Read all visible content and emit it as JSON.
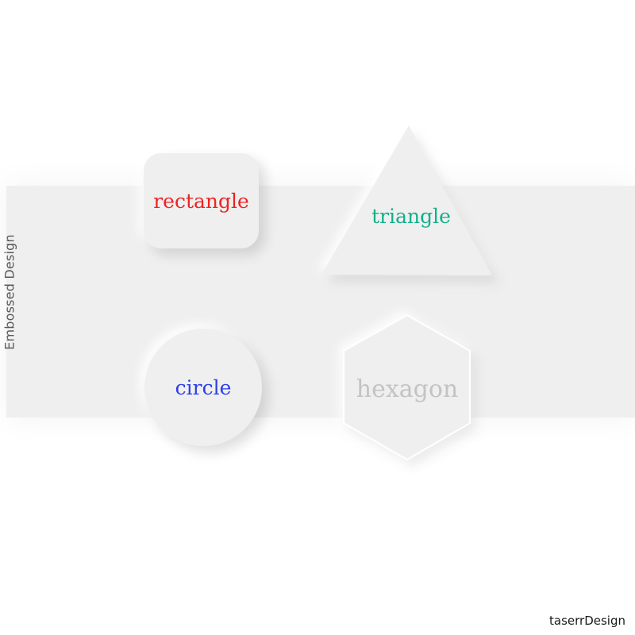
{
  "side_title": "Embossed Design",
  "credit": "taserrDesign",
  "shapes": {
    "rectangle": {
      "label": "rectangle",
      "color": "#f02222"
    },
    "triangle": {
      "label": "triangle",
      "color": "#12b08a"
    },
    "circle": {
      "label": "circle",
      "color": "#2c3ee6"
    },
    "hexagon": {
      "label": "hexagon",
      "color": "#c3c3c3"
    }
  },
  "colors": {
    "background": "#ffffff",
    "band": "#efefef",
    "shape_fill": "#efefef"
  }
}
